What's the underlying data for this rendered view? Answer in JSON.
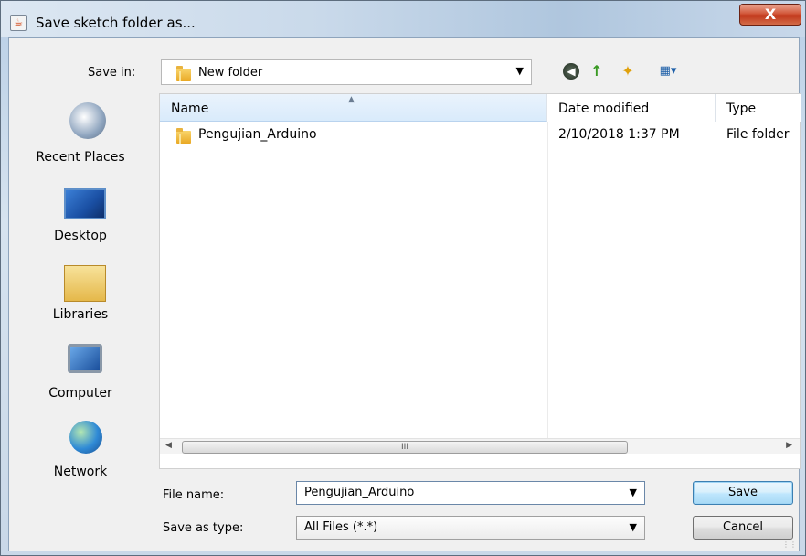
{
  "window": {
    "title": "Save sketch folder as...",
    "close_glyph": "X"
  },
  "toolbar": {
    "save_in_label": "Save in:",
    "save_in_value": "New folder",
    "icons": [
      "back-icon",
      "up-folder-icon",
      "new-folder-icon",
      "view-menu-icon"
    ]
  },
  "places": [
    {
      "label": "Recent Places",
      "icon": "recent-places-icon"
    },
    {
      "label": "Desktop",
      "icon": "desktop-icon"
    },
    {
      "label": "Libraries",
      "icon": "libraries-icon"
    },
    {
      "label": "Computer",
      "icon": "computer-icon"
    },
    {
      "label": "Network",
      "icon": "network-icon"
    }
  ],
  "file_list": {
    "columns": [
      "Name",
      "Date modified",
      "Type"
    ],
    "sorted_by": "Name",
    "rows": [
      {
        "name": "Pengujian_Arduino",
        "date_modified": "2/10/2018 1:37 PM",
        "type": "File folder"
      }
    ],
    "scroll_thumb_glyph": "III"
  },
  "form": {
    "file_name_label": "File name:",
    "file_name_value": "Pengujian_Arduino",
    "save_as_type_label": "Save as type:",
    "save_as_type_value": "All Files (*.*)"
  },
  "buttons": {
    "save": "Save",
    "cancel": "Cancel"
  },
  "colors": {
    "title_close": "#c1381c",
    "header_selected": "#d9ebfb",
    "save_button_focus": "#3c7fb1"
  }
}
